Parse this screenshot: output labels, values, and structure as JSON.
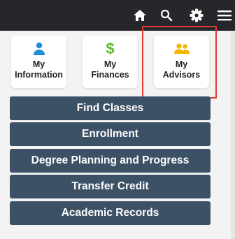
{
  "topbar": {
    "icons": [
      "home-icon",
      "search-icon",
      "gear-icon",
      "hamburger-menu-icon"
    ],
    "icon_color": "#ffffff",
    "background": "#25272b"
  },
  "tiles": [
    {
      "line1": "My",
      "line2": "Information",
      "icon": "person-icon",
      "icon_color": "#1e8fd6"
    },
    {
      "line1": "My",
      "line2": "Finances",
      "icon": "dollar-icon",
      "icon_color": "#5cb82e"
    },
    {
      "line1": "My",
      "line2": "Advisors",
      "icon": "people-icon",
      "icon_color": "#f4b400"
    }
  ],
  "highlight_color": "#e53935",
  "nav": [
    "Find Classes",
    "Enrollment",
    "Degree Planning and Progress",
    "Transfer Credit",
    "Academic Records"
  ],
  "nav_color": "#3c5066"
}
